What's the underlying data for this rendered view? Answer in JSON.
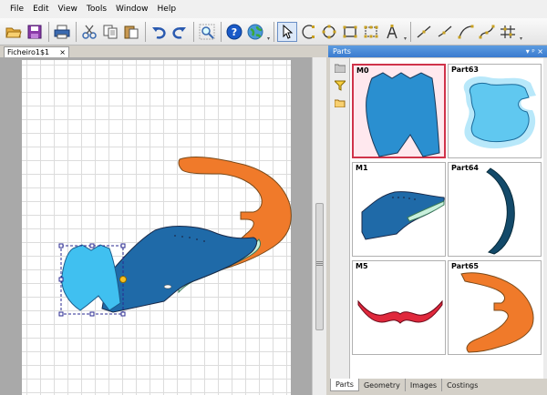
{
  "menu": [
    "File",
    "Edit",
    "View",
    "Tools",
    "Window",
    "Help"
  ],
  "toolbar": {
    "icons": [
      "open-folder-icon",
      "save-icon",
      "print-icon",
      "cut-icon",
      "copy-icon",
      "paste-icon",
      "undo-icon",
      "redo-icon",
      "zoom-icon",
      "help-icon",
      "globe-icon",
      "select-arrow-icon",
      "arc-icon",
      "circle-icon",
      "rectangle-icon",
      "selection-box-icon",
      "text-icon",
      "line-point-icon",
      "polyline-icon",
      "curve-icon",
      "bezier-icon",
      "grid-icon"
    ]
  },
  "document": {
    "tab_label": "Ficheiro1$1",
    "close_glyph": "×"
  },
  "parts_panel": {
    "title": "Parts",
    "header_icons": "▾ ᵖ ×",
    "tiles": [
      {
        "label": "M0",
        "selected": true
      },
      {
        "label": "Part63",
        "selected": false
      },
      {
        "label": "M1",
        "selected": false
      },
      {
        "label": "Part64",
        "selected": false
      },
      {
        "label": "M5",
        "selected": false
      },
      {
        "label": "Part65",
        "selected": false
      }
    ],
    "bottom_tabs": [
      "Parts",
      "Geometry",
      "Images",
      "Costings"
    ],
    "active_tab": "Parts"
  },
  "colors": {
    "blue_part": "#2a8fd0",
    "light_blue": "#40c0f0",
    "dark_blue": "#1f6aa8",
    "orange_part": "#f07a2a",
    "mint_lining": "#c8f0dc",
    "red_part": "#e0283c",
    "navy_part": "#134a6a",
    "selection": "#2a2a90",
    "handle_yellow": "#f8c020"
  }
}
